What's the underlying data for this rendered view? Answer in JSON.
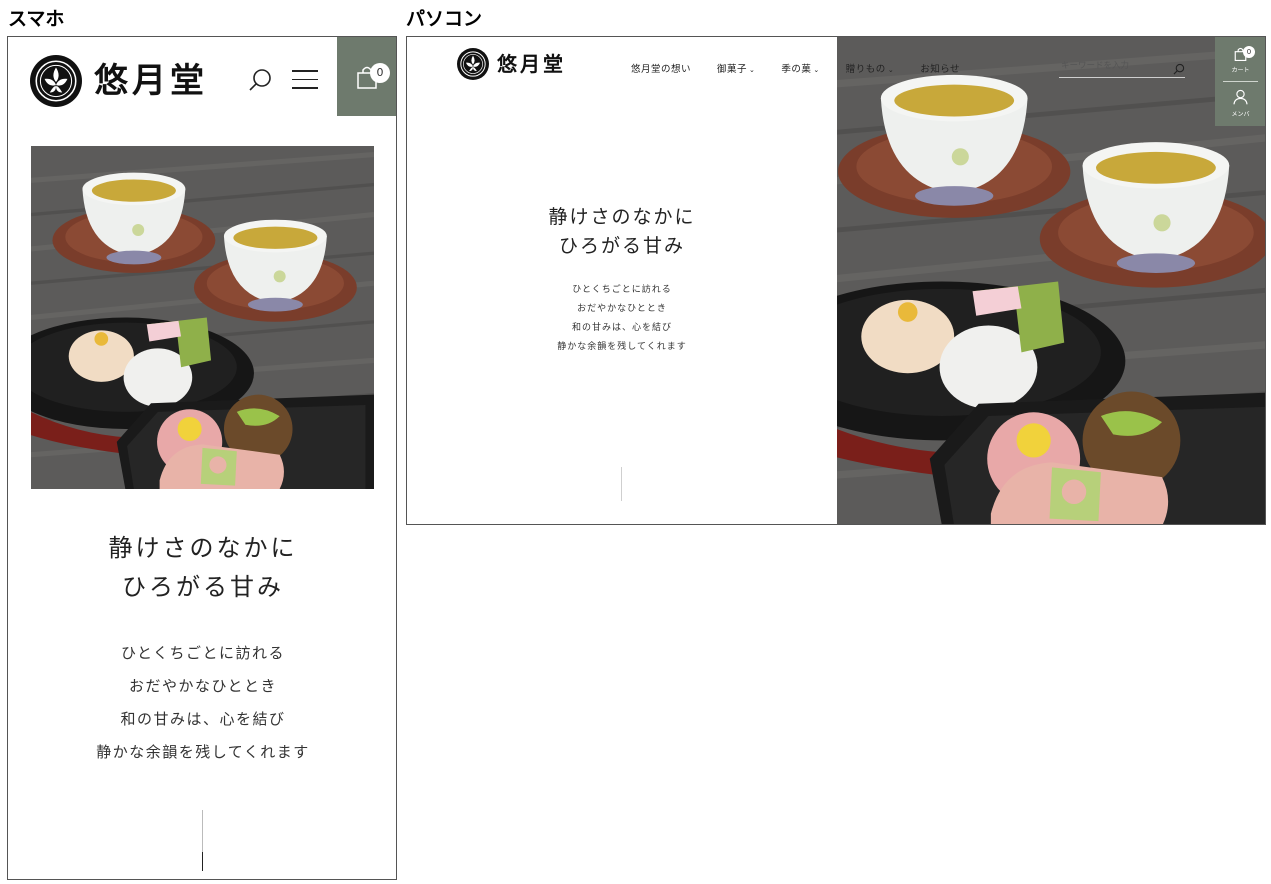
{
  "labels": {
    "mobile": "スマホ",
    "pc": "パソコン"
  },
  "brand": {
    "name": "悠月堂"
  },
  "header": {
    "cart_count": "0",
    "cart_label": "カート",
    "member_label": "メンバ"
  },
  "nav": {
    "items": [
      {
        "label": "悠月堂の想い",
        "has_dropdown": false
      },
      {
        "label": "御菓子",
        "has_dropdown": true
      },
      {
        "label": "季の菓",
        "has_dropdown": true
      },
      {
        "label": "贈りもの",
        "has_dropdown": true
      },
      {
        "label": "お知らせ",
        "has_dropdown": false
      }
    ],
    "dropdown_glyph": "⌄"
  },
  "search": {
    "placeholder": "キーワードを入力"
  },
  "hero": {
    "heading_lines": [
      "静けさのなかに",
      "ひろがる甘み"
    ],
    "copy_lines": [
      "ひとくちごとに訪れる",
      "おだやかなひととき",
      "和の甘みは、心を結び",
      "静かな余韻を残してくれます"
    ]
  },
  "colors": {
    "accent": "#6e7a6d",
    "text": "#222222",
    "background": "#ffffff"
  },
  "icons": [
    "crest-logo-icon",
    "search-icon",
    "hamburger-menu-icon",
    "shopping-bag-icon",
    "user-icon",
    "chevron-down-icon"
  ]
}
